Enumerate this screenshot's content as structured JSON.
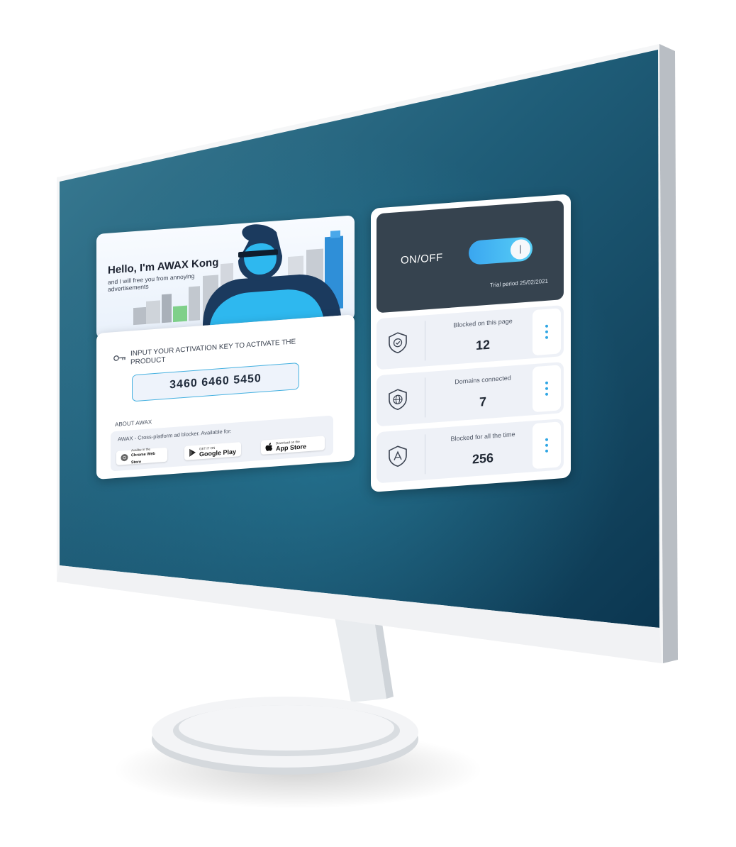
{
  "hero": {
    "title": "Hello,  I'm AWAX Kong",
    "subtitle": "and I will free you from annoying advertisements"
  },
  "activation": {
    "prompt": "INPUT YOUR ACTIVATION KEY TO ACTIVATE THE PRODUCT",
    "key": "3460  6460  5450",
    "about_label": "ABOUT AWAX",
    "about_text": "AWAX - Cross-platform ad blocker. Available for:",
    "stores": [
      {
        "small": "Availbe in the",
        "big": "Chrome Web Store",
        "icon": "chrome-icon"
      },
      {
        "small": "GET IT ON",
        "big": "Google Play",
        "icon": "google-play-icon"
      },
      {
        "small": "Download on the",
        "big": "App Store",
        "icon": "apple-icon"
      }
    ]
  },
  "status": {
    "label": "ON/OFF",
    "enabled": true,
    "trial": "Trial period  25/02/2021"
  },
  "stats": [
    {
      "label": "Blocked on this page",
      "value": "12",
      "icon": "shield-check-icon"
    },
    {
      "label": "Domains connected",
      "value": "7",
      "icon": "shield-globe-icon"
    },
    {
      "label": "Blocked for all the time",
      "value": "256",
      "icon": "shield-awax-icon"
    }
  ],
  "colors": {
    "accent": "#2fa6e4",
    "toggle_gradient_start": "#3aa6f0",
    "toggle_gradient_end": "#58d0f7",
    "dark_card": "#36434f",
    "screen_gradient_start": "#2a6f88",
    "screen_gradient_end": "#0d3d55"
  }
}
